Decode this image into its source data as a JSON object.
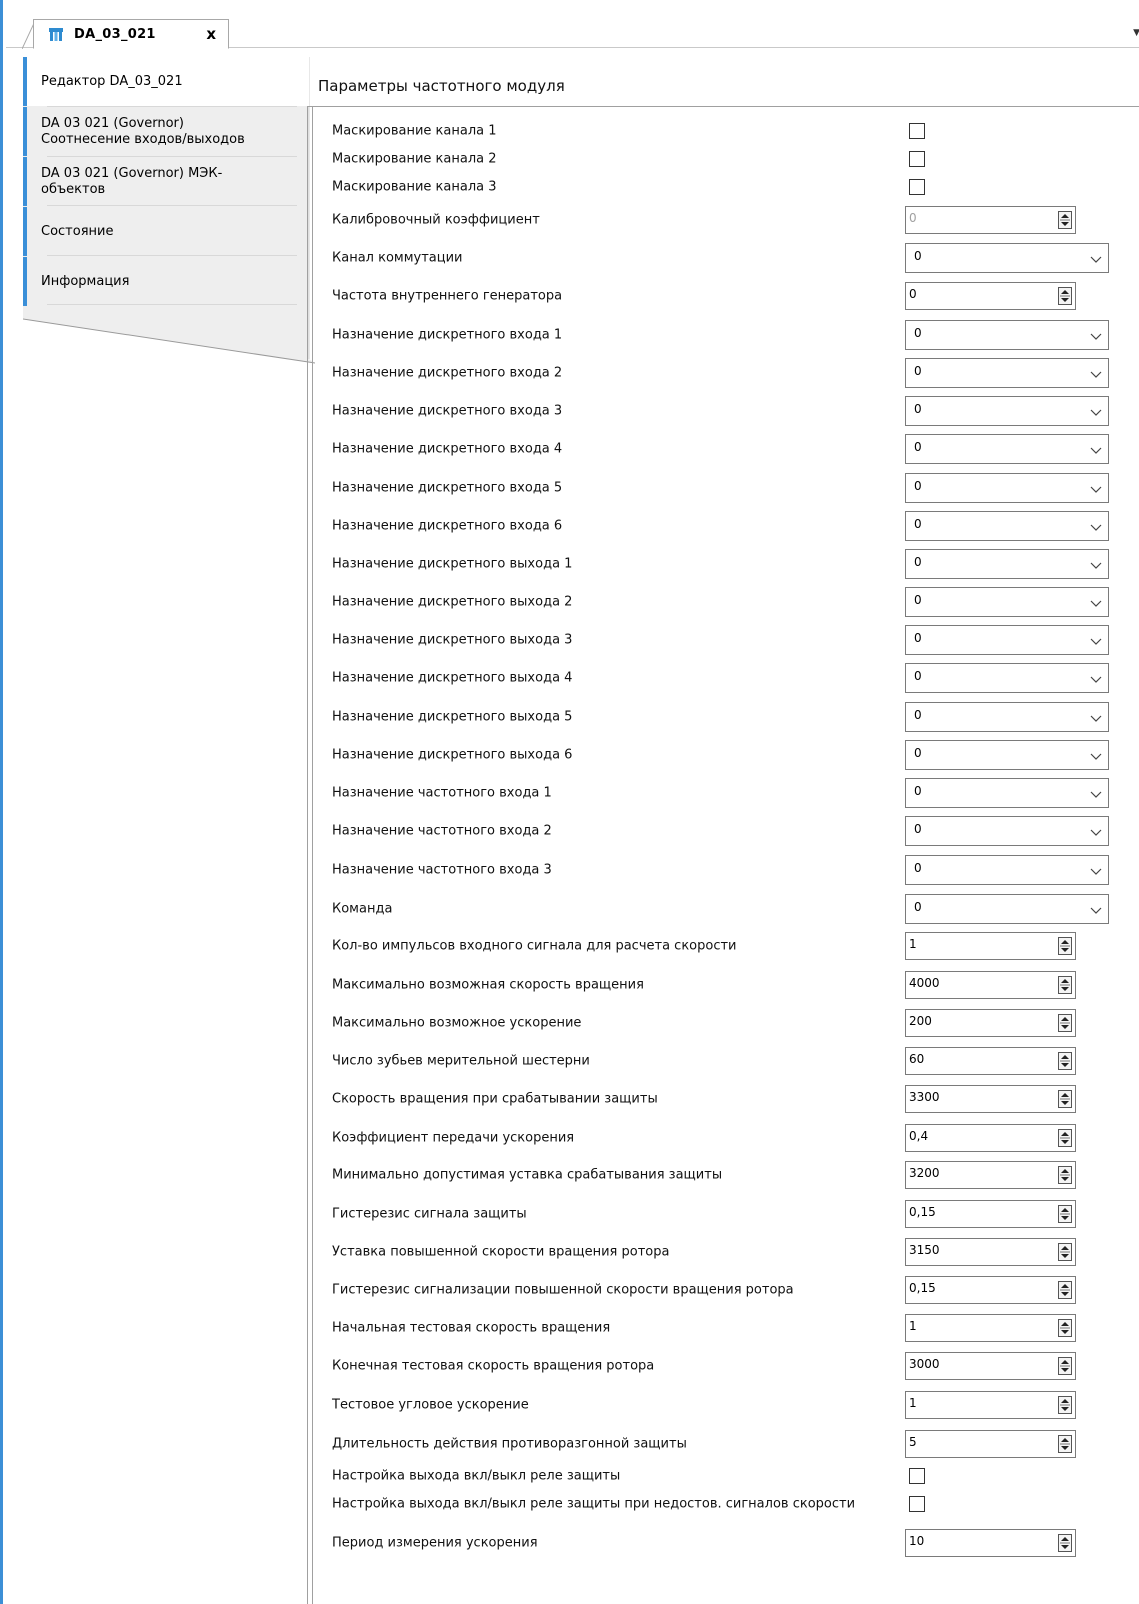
{
  "tab": {
    "title": "DA_03_021",
    "close": "x"
  },
  "nav": {
    "items": [
      {
        "lines": [
          "Редактор DA_03_021"
        ],
        "active": true
      },
      {
        "lines": [
          "DA 03 021 (Governor)",
          "Соотнесение входов/выходов"
        ],
        "active": false
      },
      {
        "lines": [
          "DA 03 021 (Governor) МЭК-",
          "объектов"
        ],
        "active": false
      },
      {
        "lines": [
          "Состояние"
        ],
        "active": false
      },
      {
        "lines": [
          "Информация"
        ],
        "active": false
      }
    ]
  },
  "main": {
    "title": "Параметры частотного модуля",
    "params": [
      {
        "label": "Маскирование канала 1",
        "type": "checkbox",
        "checked": false
      },
      {
        "label": "Маскирование канала 2",
        "type": "checkbox",
        "checked": false
      },
      {
        "label": "Маскирование канала 3",
        "type": "checkbox",
        "checked": false
      },
      {
        "label": "Калибровочный коэффициент",
        "type": "spin",
        "value": "0",
        "disabled": true
      },
      {
        "label": "Канал коммутации",
        "type": "select",
        "value": "0"
      },
      {
        "label": "Частота внутреннего генератора",
        "type": "spin",
        "value": "0"
      },
      {
        "label": "Назначение дискретного входа 1",
        "type": "select",
        "value": "0"
      },
      {
        "label": "Назначение дискретного входа 2",
        "type": "select",
        "value": "0"
      },
      {
        "label": "Назначение дискретного входа 3",
        "type": "select",
        "value": "0"
      },
      {
        "label": "Назначение дискретного входа 4",
        "type": "select",
        "value": "0"
      },
      {
        "label": "Назначение дискретного входа 5",
        "type": "select",
        "value": "0"
      },
      {
        "label": "Назначение дискретного входа 6",
        "type": "select",
        "value": "0"
      },
      {
        "label": "Назначение дискретного выхода 1",
        "type": "select",
        "value": "0"
      },
      {
        "label": "Назначение дискретного выхода 2",
        "type": "select",
        "value": "0"
      },
      {
        "label": "Назначение дискретного выхода 3",
        "type": "select",
        "value": "0"
      },
      {
        "label": "Назначение дискретного выхода 4",
        "type": "select",
        "value": "0"
      },
      {
        "label": "Назначение дискретного выхода 5",
        "type": "select",
        "value": "0"
      },
      {
        "label": "Назначение дискретного выхода 6",
        "type": "select",
        "value": "0"
      },
      {
        "label": "Назначение частотного входа 1",
        "type": "select",
        "value": "0"
      },
      {
        "label": "Назначение частотного входа 2",
        "type": "select",
        "value": "0"
      },
      {
        "label": "Назначение частотного входа 3",
        "type": "select",
        "value": "0"
      },
      {
        "label": "Команда",
        "type": "select",
        "value": "0"
      },
      {
        "label": "Кол-во импульсов входного сигнала для расчета скорости",
        "type": "spin",
        "value": "1"
      },
      {
        "label": "Максимально возможная скорость вращения",
        "type": "spin",
        "value": "4000"
      },
      {
        "label": "Максимально возможное ускорение",
        "type": "spin",
        "value": "200"
      },
      {
        "label": "Число зубьев мерительной шестерни",
        "type": "spin",
        "value": "60"
      },
      {
        "label": "Скорость вращения при срабатывании защиты",
        "type": "spin",
        "value": "3300"
      },
      {
        "label": "Коэффициент передачи ускорения",
        "type": "spin",
        "value": "0,4"
      },
      {
        "label": "Минимально допустимая уставка срабатывания защиты",
        "type": "spin",
        "value": "3200"
      },
      {
        "label": "Гистерезис сигнала защиты",
        "type": "spin",
        "value": "0,15"
      },
      {
        "label": "Уставка повышенной скорости вращения ротора",
        "type": "spin",
        "value": "3150"
      },
      {
        "label": "Гистерезис сигнализации повышенной скорости вращения ротора",
        "type": "spin",
        "value": "0,15"
      },
      {
        "label": "Начальная тестовая скорость вращения",
        "type": "spin",
        "value": "1"
      },
      {
        "label": "Конечная тестовая скорость вращения ротора",
        "type": "spin",
        "value": "3000"
      },
      {
        "label": "Тестовое угловое ускорение",
        "type": "spin",
        "value": "1"
      },
      {
        "label": "Длительность действия противоразгонной защиты",
        "type": "spin",
        "value": "5"
      },
      {
        "label": "Настройка выхода вкл/выкл реле защиты",
        "type": "checkbox",
        "checked": false
      },
      {
        "label": "Настройка выхода вкл/выкл реле защиты при недостов. сигналов скорости",
        "type": "checkbox",
        "checked": false
      },
      {
        "label": "Период измерения ускорения",
        "type": "spin",
        "value": "10"
      }
    ]
  },
  "colors": {
    "accent": "#3a8fd8",
    "frame": "#3c8fd6",
    "nav_bg": "#eeeeee",
    "border": "#7a7a7a"
  },
  "icons": {
    "tab": "device-icon",
    "select_arrow": "chevron-down-icon",
    "spin": "spin-updown-icon"
  }
}
